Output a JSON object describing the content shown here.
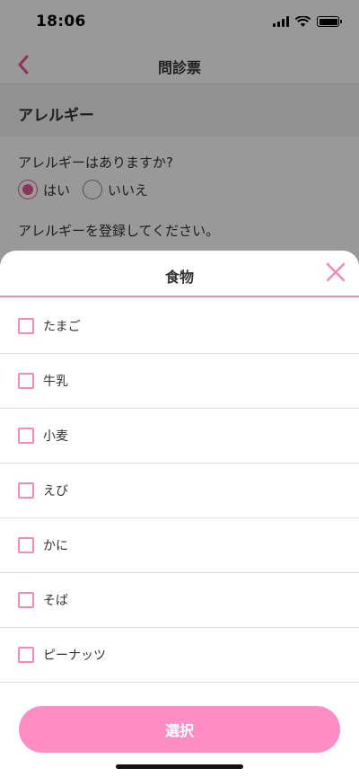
{
  "status_bar": {
    "time": "18:06",
    "signal_icon": "signal-icon",
    "wifi_icon": "wifi-icon",
    "battery_icon": "battery-icon"
  },
  "nav": {
    "title": "問診票",
    "back_icon": "chevron-left-icon"
  },
  "section": {
    "title": "アレルギー"
  },
  "question": {
    "text": "アレルギーはありますか?",
    "options": [
      {
        "label": "はい",
        "selected": true
      },
      {
        "label": "いいえ",
        "selected": false
      }
    ],
    "register_text": "アレルギーを登録してください。"
  },
  "sheet": {
    "title": "食物",
    "close_icon": "close-icon",
    "items": [
      {
        "label": "たまご",
        "checked": false
      },
      {
        "label": "牛乳",
        "checked": false
      },
      {
        "label": "小麦",
        "checked": false
      },
      {
        "label": "えび",
        "checked": false
      },
      {
        "label": "かに",
        "checked": false
      },
      {
        "label": "そば",
        "checked": false
      },
      {
        "label": "ピーナッツ",
        "checked": false
      }
    ],
    "button_label": "選択"
  },
  "colors": {
    "accent": "#e8589a",
    "pink_border": "#f28ab8",
    "button": "#ff8ec4"
  }
}
